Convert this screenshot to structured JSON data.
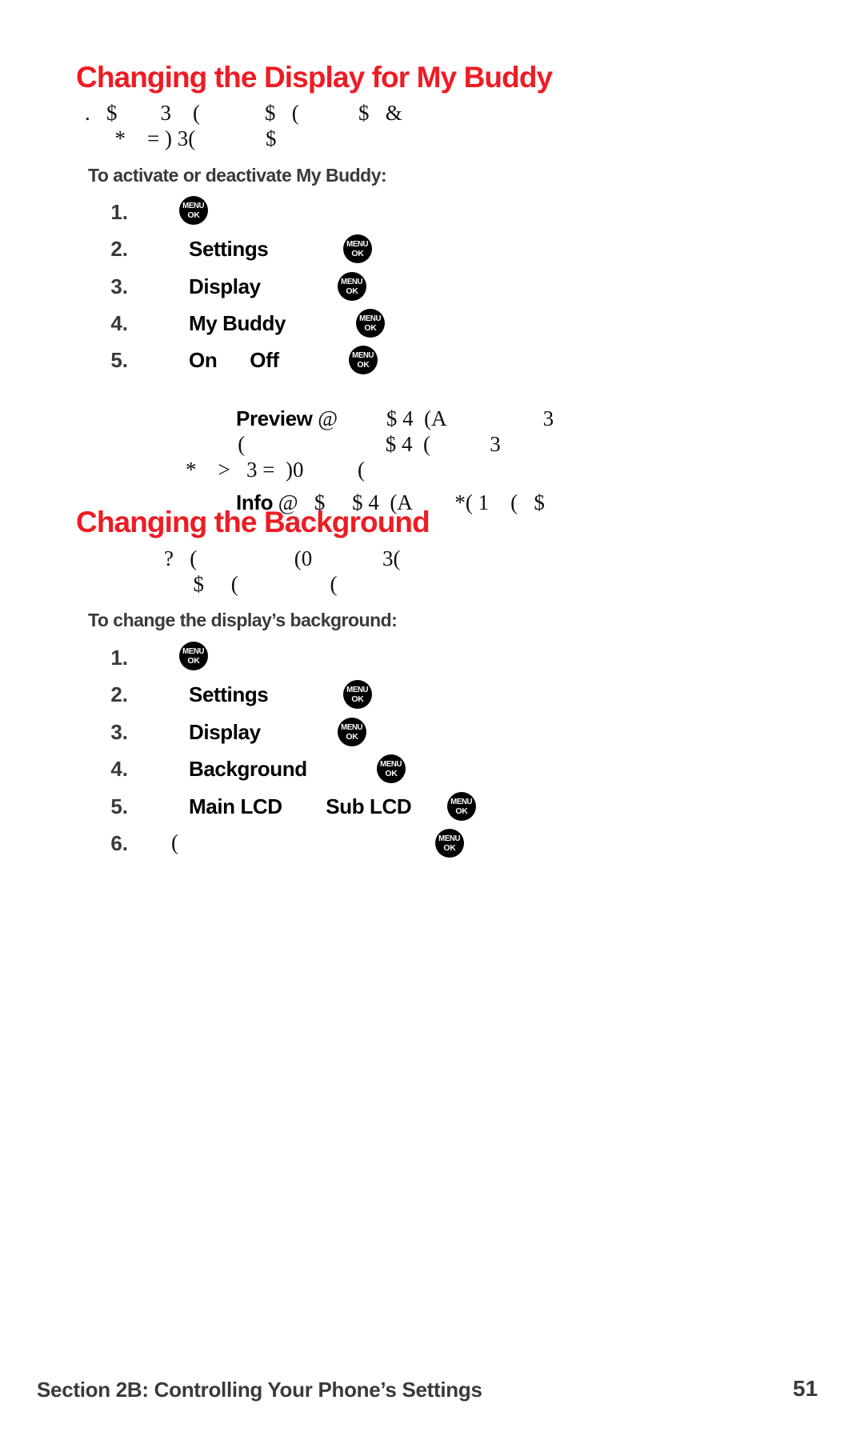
{
  "page": {
    "number": "51",
    "background_color": "#ffffff"
  },
  "colors": {
    "heading_red": "#ed1c24",
    "subheading_gray": "#3a3a3a",
    "body_black": "#101010",
    "icon_black": "#000000"
  },
  "sections": [
    {
      "id": "my-buddy",
      "heading": "Changing the Display for My Buddy",
      "intro_lines": [
        ".   $        3    (            $   (           $   &",
        "  *    = ) 3(             $"
      ],
      "subheading": "To activate or deactivate My Buddy:",
      "steps": [
        {
          "num": "1.",
          "term": "",
          "icon": "menu-ok-icon",
          "trail": ""
        },
        {
          "num": "2.",
          "term": "Settings",
          "icon": "menu-ok-icon",
          "trail": ""
        },
        {
          "num": "3.",
          "term": "Display",
          "icon": "menu-ok-icon",
          "trail": ""
        },
        {
          "num": "4.",
          "term": "My Buddy",
          "icon": "menu-ok-icon",
          "trail": ""
        },
        {
          "num": "5.",
          "term": "On      Off",
          "icon": "menu-ok-icon",
          "trail": ""
        }
      ],
      "notes": [
        {
          "bold": "Preview",
          "rest": " @         $ 4  (A                  3"
        },
        {
          "bold": "",
          "rest": "   (                          $ 4  (           3"
        },
        {
          "bold": "",
          "rest": "*    >   3 =  )0          ("
        },
        {
          "bold": "Info",
          "rest": " @   $     $ 4  (A        *( 1    (   $"
        }
      ]
    },
    {
      "id": "background",
      "heading": "Changing the Background",
      "intro_lines": [
        "?   (                  (0             3(",
        "  $     (                 ("
      ],
      "subheading": "To change the display’s background:",
      "steps": [
        {
          "num": "1.",
          "term": "",
          "icon": "menu-ok-icon",
          "trail": ""
        },
        {
          "num": "2.",
          "term": "Settings",
          "icon": "menu-ok-icon",
          "trail": ""
        },
        {
          "num": "3.",
          "term": "Display",
          "icon": "menu-ok-icon",
          "trail": ""
        },
        {
          "num": "4.",
          "term": "Background",
          "icon": "menu-ok-icon",
          "trail": ""
        },
        {
          "num": "5.",
          "term": "Main LCD        Sub LCD",
          "icon": "menu-ok-icon",
          "trail": ""
        },
        {
          "num": "6.",
          "term": "",
          "icon": "menu-ok-icon",
          "trail": "("
        }
      ],
      "notes": []
    }
  ],
  "footer": {
    "section_label": "Section 2B: Controlling Your Phone’s Settings",
    "page_number": "51"
  },
  "icon_labels": {
    "menu": "MENU",
    "ok": "OK"
  }
}
